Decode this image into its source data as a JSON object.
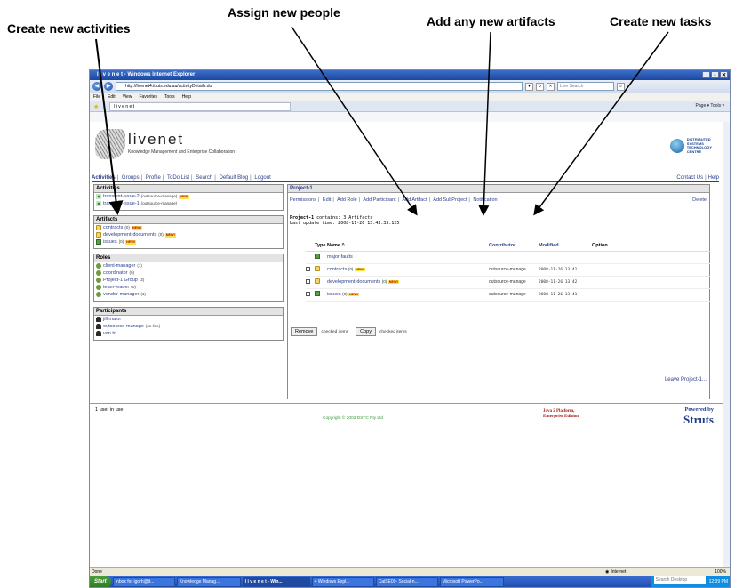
{
  "callouts": {
    "activities": "Create new activities",
    "people": "Assign new people",
    "artifacts": "Add any new artifacts",
    "tasks": "Create new tasks"
  },
  "browser": {
    "title": "l i v e n e t - Windows Internet Explorer",
    "url": "http://livenet4.it.uts.edu.au/activityDetails.do",
    "search_placeholder": "Live Search",
    "menu": [
      "File",
      "Edit",
      "View",
      "Favorites",
      "Tools",
      "Help"
    ],
    "tab_title": "l i v e n e t",
    "toolbar_right": "Page ▾  Tools ▾",
    "status": "Done",
    "zone": "Internet",
    "zoom": "100%"
  },
  "site": {
    "logo": "livenet",
    "subtitle": "Knowledge Management and Enterprise Collaboration",
    "org": [
      "DISTRIBUTED",
      "SYSTEMS",
      "TECHNOLOGY",
      "CENTRE"
    ]
  },
  "nav": {
    "items": [
      "Activities",
      "Groups",
      "Profile",
      "ToDo List",
      "Search",
      "Default Blog",
      "Logout"
    ],
    "contact": "Contact Us",
    "help": "Help"
  },
  "new_badge": "NEW!",
  "sidebar": {
    "activities_title": "Activities",
    "activities": [
      {
        "name": "transient-issue-2",
        "sub": "(outsource-manage)",
        "new": true
      },
      {
        "name": "transient-issue-1",
        "sub": "(outsource-manage)",
        "new": false
      }
    ],
    "artifacts_title": "Artifacts",
    "artifacts": [
      {
        "name": "contracts",
        "sub": "(0)",
        "new": true
      },
      {
        "name": "development-documents",
        "sub": "(0)",
        "new": true
      },
      {
        "name": "issues",
        "sub": "(0)",
        "new": true
      }
    ],
    "roles_title": "Roles",
    "roles": [
      {
        "name": "client-manager",
        "sub": "(1)"
      },
      {
        "name": "coordinator",
        "sub": "(0)"
      },
      {
        "name": "Project-1 Group",
        "sub": "(2)"
      },
      {
        "name": "team-leader",
        "sub": "(0)"
      },
      {
        "name": "vendor-manager",
        "sub": "(1)"
      }
    ],
    "participants_title": "Participants",
    "participants": [
      {
        "name": "jill major",
        "sub": ""
      },
      {
        "name": "outsource-manage",
        "sub": "(on line)"
      },
      {
        "name": "van to",
        "sub": ""
      }
    ]
  },
  "project": {
    "title": "Project-1",
    "links": [
      "Permissions",
      "Edit",
      "Add Role",
      "Add Participant",
      "Add Artifact",
      "Add SubProject",
      "Notification"
    ],
    "delete": "Delete",
    "contains_name": "Project-1",
    "contains_text": " contains: 3 Artifacts",
    "last_update": "Last update time: 2008-11-26 13:43:33.125",
    "columns": {
      "type": "Type",
      "name": "Name ^",
      "contributor": "Contributor",
      "modified": "Modified",
      "option": "Option"
    },
    "rows": [
      {
        "name": "major-faults",
        "count": "",
        "new": false,
        "contributor": "",
        "modified": "",
        "icon": "doc",
        "check": false
      },
      {
        "name": "contracts",
        "count": "(0)",
        "new": true,
        "contributor": "outsource-manage",
        "modified": "2008-11-26 13:41",
        "icon": "folder",
        "check": true
      },
      {
        "name": "development-documents",
        "count": "(0)",
        "new": true,
        "contributor": "outsource-manage",
        "modified": "2008-11-26 13:42",
        "icon": "folder",
        "check": true
      },
      {
        "name": "issues",
        "count": "(0)",
        "new": true,
        "contributor": "outsource-manage",
        "modified": "2008-11-26 13:41",
        "icon": "doc",
        "check": true
      }
    ],
    "remove_label": "Remove",
    "copy_label": "Copy",
    "checked_items": "checked items",
    "leave": "Leave Project-1..."
  },
  "footer": {
    "users": "1 user in use.",
    "copyright": "Copyright © 2002 DSTC Pty Ltd",
    "java": [
      "Java 2 Platform,",
      "Enterprise Edition"
    ],
    "powered": "Powered by",
    "struts": "Struts"
  },
  "taskbar": {
    "start": "Start",
    "tasks": [
      "Inbox for igorh@it...",
      "Knowledge Manag...",
      "l i v e n e t - Win...",
      "4 Windows Expl...",
      "CaiSE09- Social-n...",
      "Microsoft PowerPo..."
    ],
    "active_index": 2,
    "search": "Search Desktop",
    "clock": "12:39 PM"
  }
}
